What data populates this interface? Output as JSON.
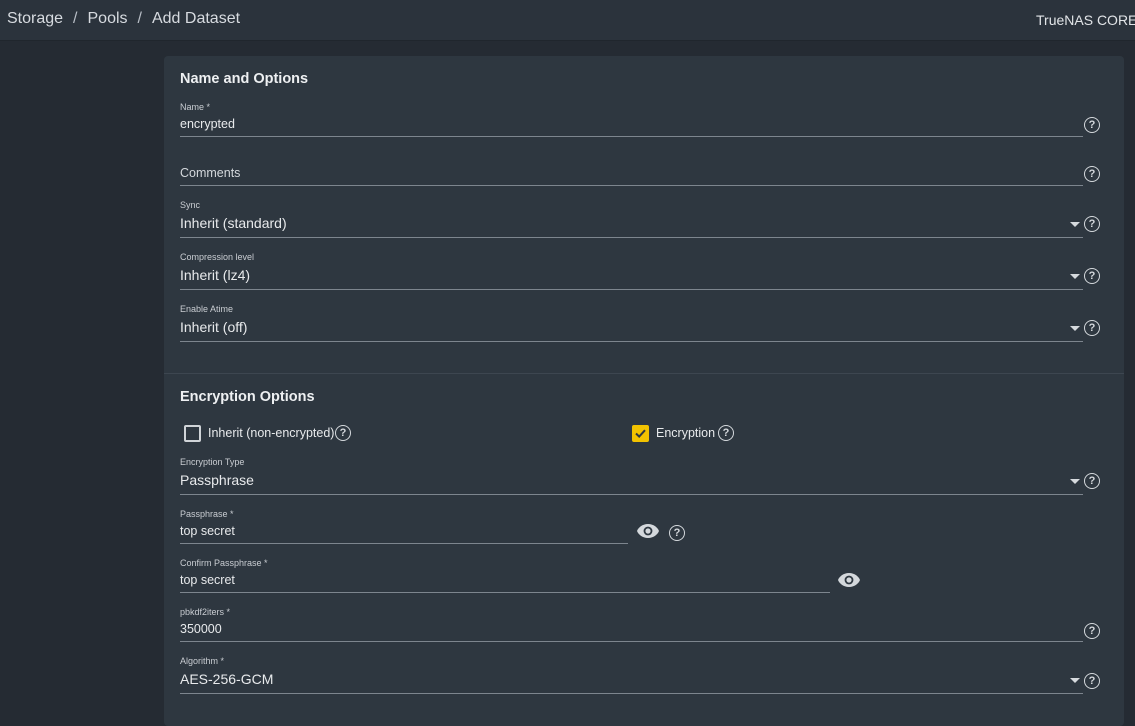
{
  "breadcrumb": {
    "items": [
      "Storage",
      "Pools",
      "Add Dataset"
    ],
    "separator": "/"
  },
  "header": {
    "product": "TrueNAS CORE©"
  },
  "colors": {
    "accent": "#f2c200",
    "background": "#252b33",
    "card": "#2e3740"
  },
  "name_options": {
    "title": "Name and Options",
    "name": {
      "label": "Name *",
      "value": "encrypted"
    },
    "comments": {
      "placeholder": "Comments"
    },
    "sync": {
      "label": "Sync",
      "value": "Inherit (standard)"
    },
    "compression": {
      "label": "Compression level",
      "value": "Inherit (lz4)"
    },
    "atime": {
      "label": "Enable Atime",
      "value": "Inherit (off)"
    }
  },
  "encryption_options": {
    "title": "Encryption Options",
    "inherit": {
      "label": "Inherit (non-encrypted)",
      "checked": false
    },
    "encryption": {
      "label": "Encryption",
      "checked": true
    },
    "type": {
      "label": "Encryption Type",
      "value": "Passphrase"
    },
    "passphrase": {
      "label": "Passphrase *",
      "value": "top secret"
    },
    "confirm_passphrase": {
      "label": "Confirm Passphrase *",
      "value": "top secret"
    },
    "pbkdf2iters": {
      "label": "pbkdf2iters *",
      "value": "350000"
    },
    "algorithm": {
      "label": "Algorithm *",
      "value": "AES-256-GCM"
    }
  },
  "icons": {
    "help": "help-circle-icon",
    "visibility": "eye-icon",
    "dropdown": "caret-down-icon",
    "check": "check-icon"
  },
  "help_glyph": "?"
}
